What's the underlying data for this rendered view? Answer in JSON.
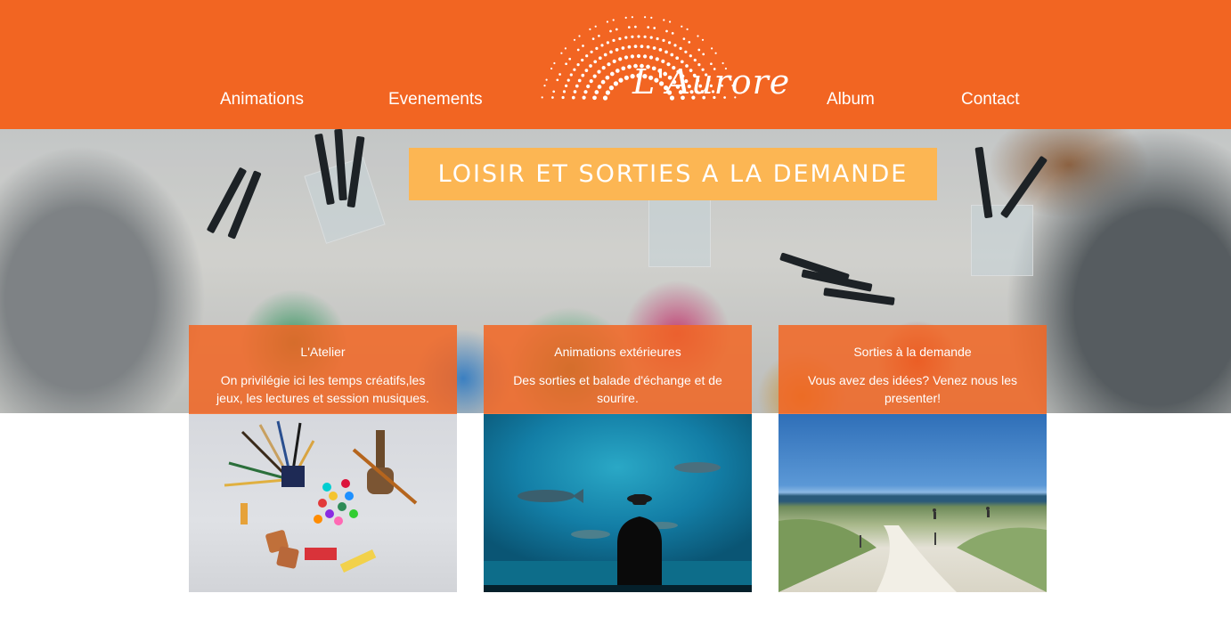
{
  "header": {
    "nav_left": [
      "Animations",
      "Evenements"
    ],
    "nav_right": [
      "Album",
      "Contact"
    ],
    "logo_text": "L'Aurore"
  },
  "hero": {
    "banner_text": "LOISIR ET SORTIES A LA DEMANDE"
  },
  "cards": [
    {
      "title": "L'Atelier",
      "description": "On privilégie ici les temps créatifs,les jeux, les lectures et session musiques."
    },
    {
      "title": "Animations extérieures",
      "description": "Des sorties et balade d'échange et de sourire."
    },
    {
      "title": "Sorties à la demande",
      "description": "Vous avez des idées? Venez nous les presenter!"
    }
  ],
  "colors": {
    "brand_orange": "#f26522",
    "banner_yellow": "#fcb653",
    "text_white": "#ffffff"
  },
  "icons": [
    "logo-sunburst-icon"
  ]
}
